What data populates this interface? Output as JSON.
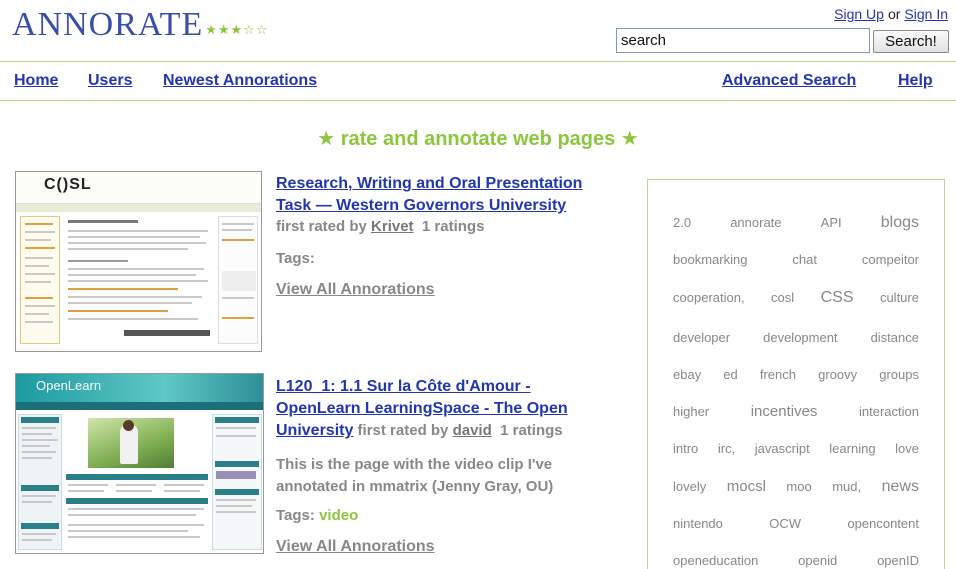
{
  "header": {
    "logo": "ANNORATE",
    "logo_stars": "★★★☆☆",
    "sign_up": "Sign Up",
    "or": "or",
    "sign_in": "Sign In",
    "search_value": "search",
    "search_button": "Search!"
  },
  "nav": {
    "home": "Home",
    "users": "Users",
    "newest": "Newest Annorations",
    "advanced_search": "Advanced Search",
    "help": "Help"
  },
  "tagline": "★ rate and annotate web pages ★",
  "entries": [
    {
      "title_line1": "Research, Writing and Oral Presentation",
      "title_line2": "Task — Western Governors University",
      "first_rated_by": "first rated by",
      "user": "Krivet",
      "ratings": "1 ratings",
      "tags_label": "Tags:",
      "tags": "",
      "view_all": "View All Annorations",
      "thumb_logo_a": "C(",
      "thumb_logo_b": ")SL"
    },
    {
      "title_line1": "L120_1: 1.1 Sur la Côte d'Amour -",
      "title_line2": "OpenLearn LearningSpace - The Open",
      "title_line3": "University",
      "first_rated_by": "first rated by",
      "user": "david",
      "ratings": "1 ratings",
      "description_line1": "This is the page with the video clip I've",
      "description_line2": "annotated in mmatrix (Jenny Gray, OU)",
      "tags_label": "Tags:",
      "tags": "video",
      "view_all": "View All Annorations",
      "thumb_logo": "OpenLearn"
    }
  ],
  "tag_cloud": [
    [
      "2.0",
      "annorate",
      "API",
      "blogs"
    ],
    [
      "bookmarking",
      "chat",
      "compeitor"
    ],
    [
      "cooperation,",
      "cosl",
      "CSS",
      "culture"
    ],
    [
      "developer",
      "development",
      "distance"
    ],
    [
      "ebay",
      "ed",
      "french",
      "groovy",
      "groups"
    ],
    [
      "higher",
      "incentives",
      "interaction"
    ],
    [
      "intro",
      "irc,",
      "javascript",
      "learning",
      "love"
    ],
    [
      "lovely",
      "mocsl",
      "moo",
      "mud,",
      "news"
    ],
    [
      "nintendo",
      "OCW",
      "opencontent"
    ],
    [
      "openeducation",
      "openid",
      "openID"
    ]
  ],
  "colors": {
    "link": "#2236b4",
    "accent": "#8cc63f",
    "muted": "#888888",
    "logo": "#3a4ea8"
  }
}
